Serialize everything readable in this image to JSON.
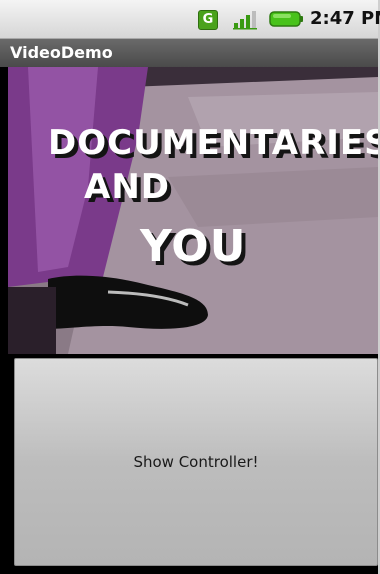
{
  "status_bar": {
    "network_badge": "G",
    "signal_icon": "signal-strength-icon",
    "battery_icon": "battery-icon",
    "time": "2:47 PM",
    "colors": {
      "network": "#4aa21c",
      "battery": "#48c21a"
    }
  },
  "app": {
    "title": "VideoDemo"
  },
  "video": {
    "caption_line1": "DOCUMENTARIES",
    "caption_line2": "AND",
    "caption_line3": "YOU"
  },
  "controller": {
    "button_label": "Show Controller!"
  }
}
